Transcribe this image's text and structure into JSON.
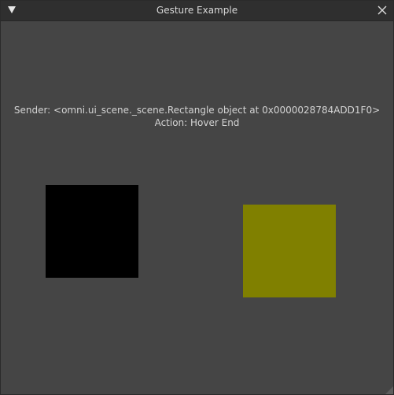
{
  "window": {
    "title": "Gesture Example",
    "collapse_icon": "triangle-down-icon",
    "close_icon": "close-icon"
  },
  "info": {
    "sender_line": "Sender: <omni.ui_scene._scene.Rectangle object at 0x0000028784ADD1F0>",
    "action_line": "Action: Hover End"
  },
  "rectangles": [
    {
      "name": "black-rectangle",
      "color": "#000000"
    },
    {
      "name": "olive-rectangle",
      "color": "#808000"
    }
  ],
  "colors": {
    "background": "#454545",
    "titlebar": "#2f2f2f",
    "text": "#d4d4d4"
  }
}
